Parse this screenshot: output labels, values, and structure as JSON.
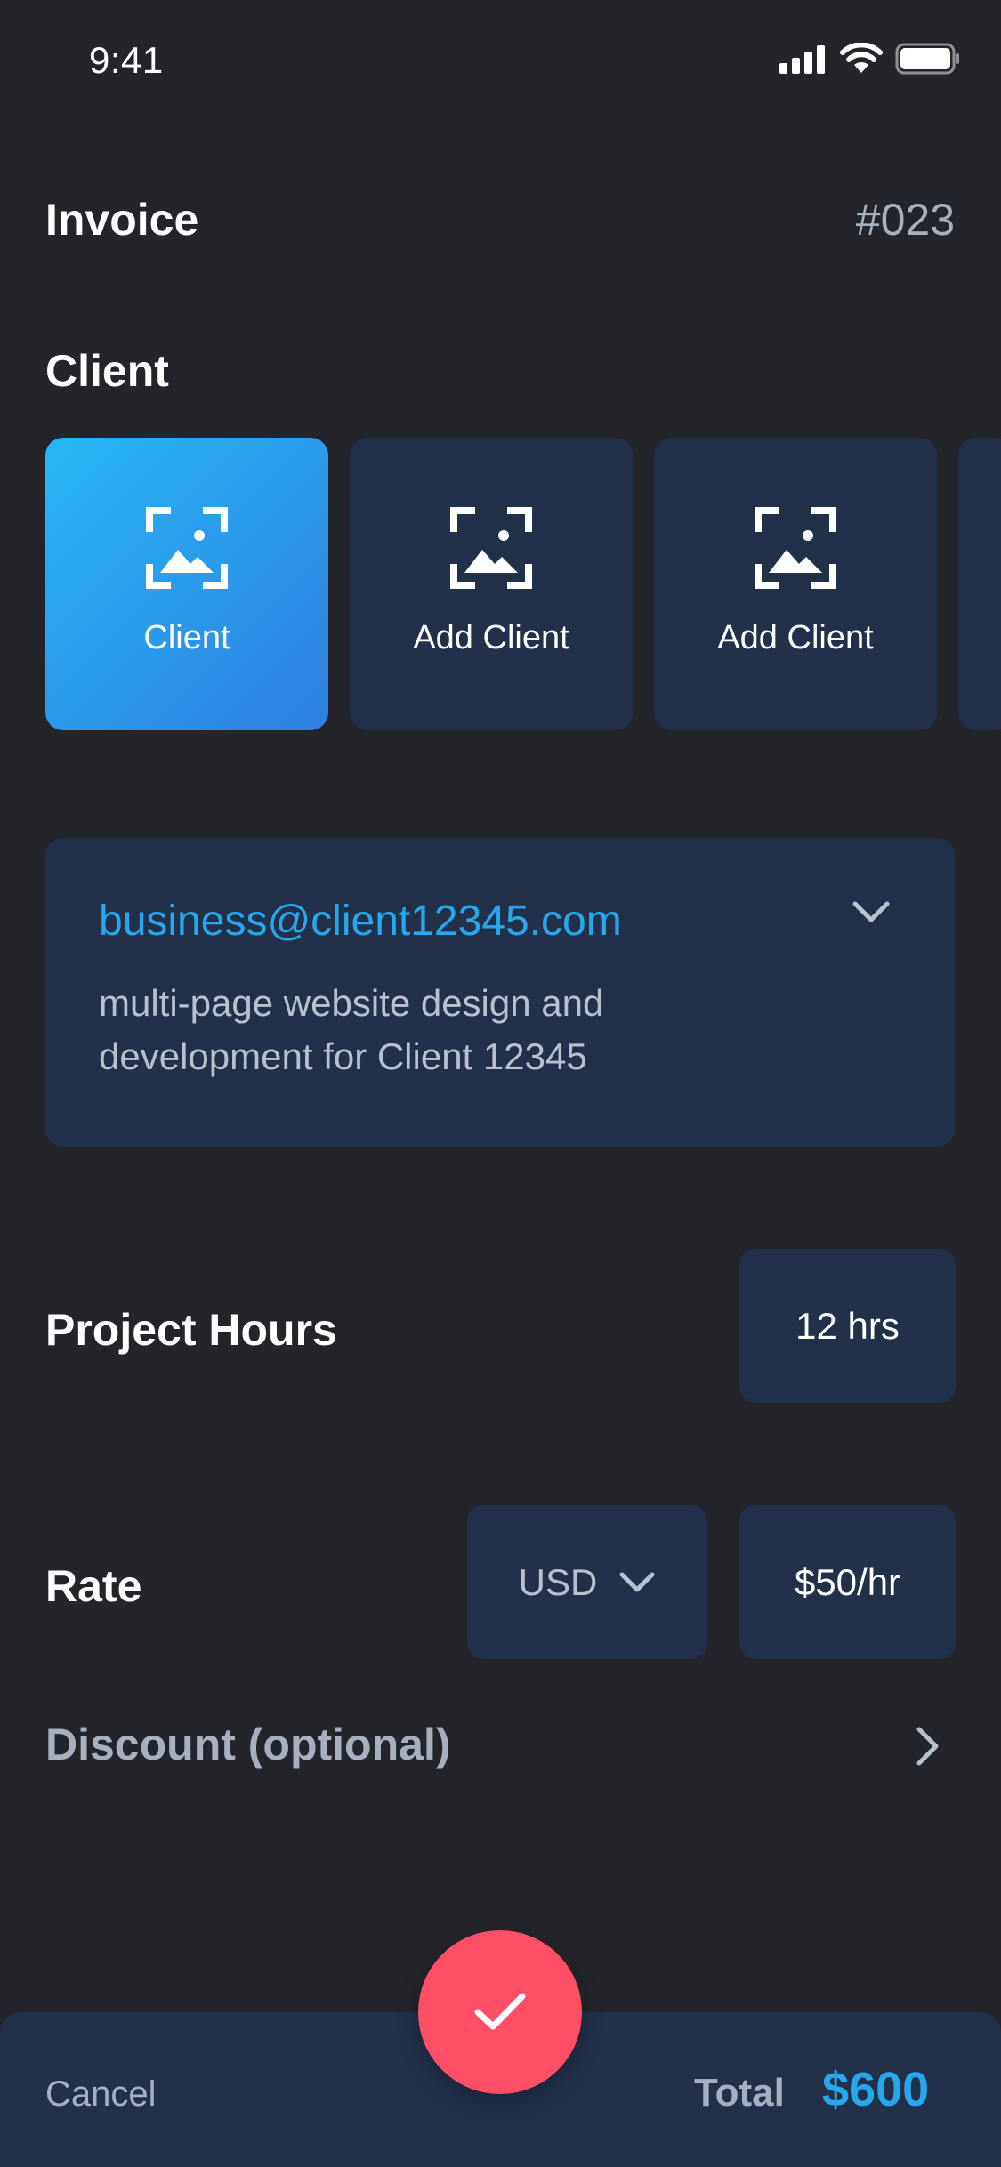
{
  "status_bar": {
    "time": "9:41"
  },
  "header": {
    "title": "Invoice",
    "number": "#023"
  },
  "client_section": {
    "heading": "Client",
    "cards": [
      {
        "label": "Client",
        "active": true
      },
      {
        "label": "Add Client",
        "active": false
      },
      {
        "label": "Add Client",
        "active": false
      }
    ]
  },
  "client_details": {
    "email": "business@client12345.com",
    "description": "multi-page website design and development for Client 12345"
  },
  "project_hours": {
    "label": "Project Hours",
    "value": "12 hrs"
  },
  "rate": {
    "label": "Rate",
    "currency": "USD",
    "value": "$50/hr"
  },
  "discount": {
    "label": "Discount (optional)"
  },
  "footer": {
    "cancel_label": "Cancel",
    "total_label": "Total",
    "total_value": "$600"
  },
  "colors": {
    "background": "#23252b",
    "card": "#22304a",
    "accent": "#26a8ee",
    "confirm": "#ff4f66"
  },
  "icons": {
    "status": [
      "cellular-signal-icon",
      "wifi-icon",
      "battery-icon"
    ],
    "client_card": "image-placeholder-icon",
    "email_dropdown": "chevron-down-icon",
    "currency_dropdown": "chevron-down-icon",
    "discount": "chevron-right-icon",
    "confirm": "checkmark-icon"
  }
}
